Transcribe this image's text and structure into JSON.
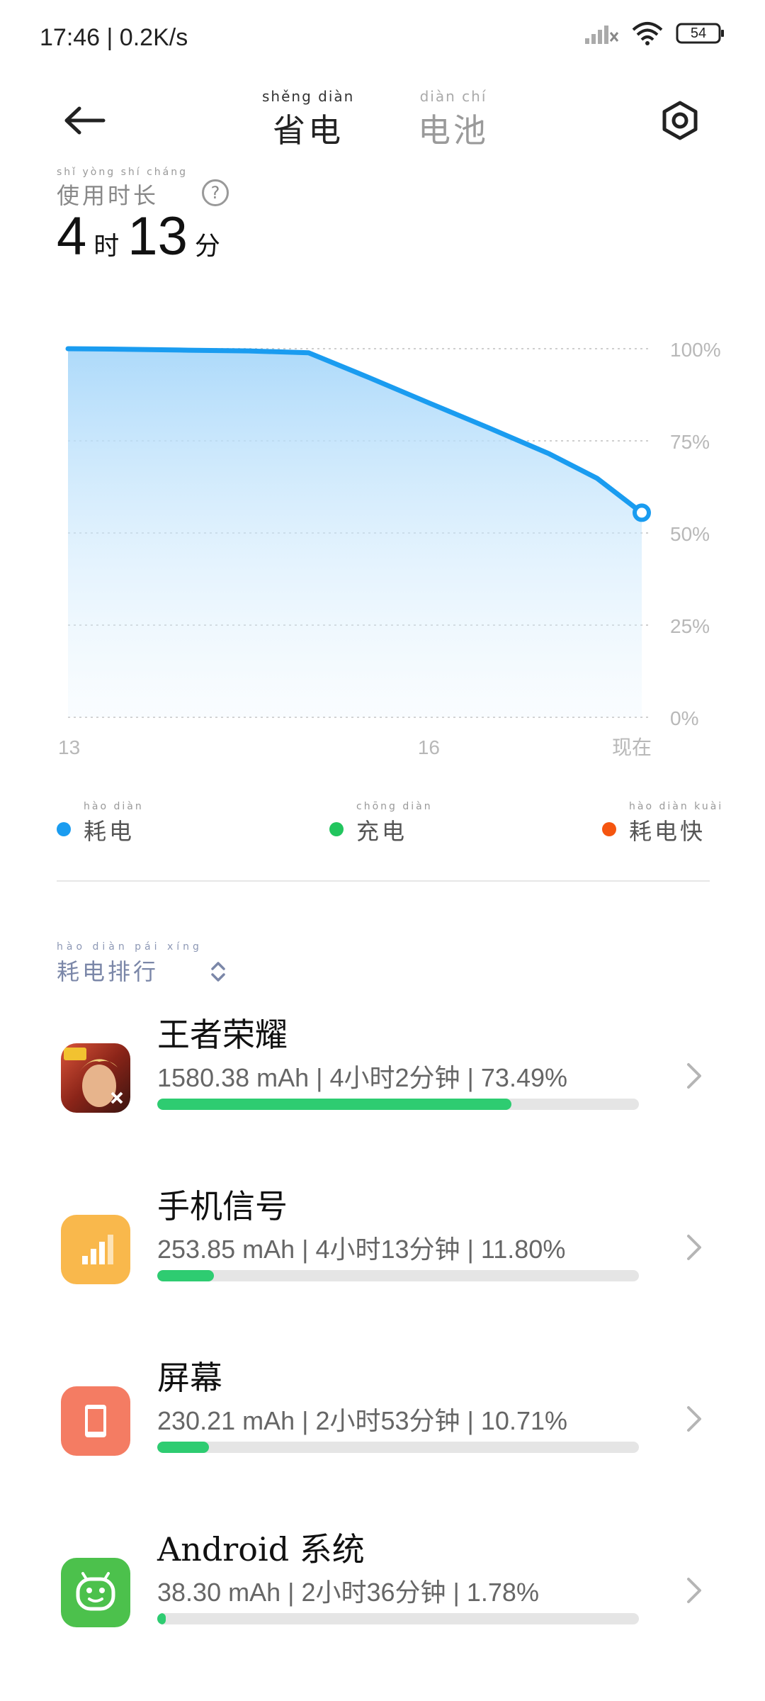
{
  "status_bar": {
    "time_speed": "17:46 | 0.2K/s",
    "battery_level": "54"
  },
  "header": {
    "tabs": [
      {
        "pinyin": "shěng diàn",
        "label": "省电"
      },
      {
        "pinyin": "diàn chí",
        "label": "电池"
      }
    ]
  },
  "usage": {
    "label_pinyin": "shǐ yòng shí cháng",
    "label": "使用时长",
    "help": "?",
    "hours": "4",
    "hours_unit": "时",
    "minutes": "13",
    "minutes_unit": "分"
  },
  "chart_data": {
    "type": "area",
    "x_ticks": [
      "13",
      "16",
      "现在"
    ],
    "y_ticks": [
      "100%",
      "75%",
      "50%",
      "25%",
      "0%"
    ],
    "ylim": [
      0,
      100
    ],
    "x": [
      13.0,
      13.35,
      14.0,
      14.5,
      15.0,
      15.5,
      16.0,
      16.5,
      17.0,
      17.4,
      17.77
    ],
    "values": [
      100,
      99.9,
      99.6,
      99.4,
      98.9,
      92.2,
      85.3,
      78.5,
      71.5,
      64.8,
      55.5
    ],
    "line_color": "#1a9cf0",
    "grid": true
  },
  "legend": [
    {
      "pinyin": "hào diàn",
      "label": "耗电",
      "color": "#1a9cf0"
    },
    {
      "pinyin": "chōng diàn",
      "label": "充电",
      "color": "#22c55e"
    },
    {
      "pinyin": "hào diàn kuài",
      "label": "耗电快",
      "color": "#f5550f"
    }
  ],
  "ranking": {
    "pinyin": "hào diàn pái xíng",
    "label": "耗电排行"
  },
  "apps": [
    {
      "name": "王者荣耀",
      "stats": "1580.38 mAh | 4小时2分钟 | 73.49%",
      "fraction": 0.7349,
      "icon": "game-icon",
      "icon_color": "#b23a2a"
    },
    {
      "name": "手机信号",
      "stats": "253.85 mAh | 4小时13分钟 | 11.80%",
      "fraction": 0.118,
      "icon": "signal-icon",
      "icon_color": "#f9b84c"
    },
    {
      "name": "屏幕",
      "stats": "230.21 mAh | 2小时53分钟 | 10.71%",
      "fraction": 0.1071,
      "icon": "screen-icon",
      "icon_color": "#f47c63"
    },
    {
      "name": "Android 系统",
      "stats": "38.30 mAh | 2小时36分钟 | 1.78%",
      "fraction": 0.0178,
      "icon": "android-icon",
      "icon_color": "#4cc14c"
    }
  ]
}
